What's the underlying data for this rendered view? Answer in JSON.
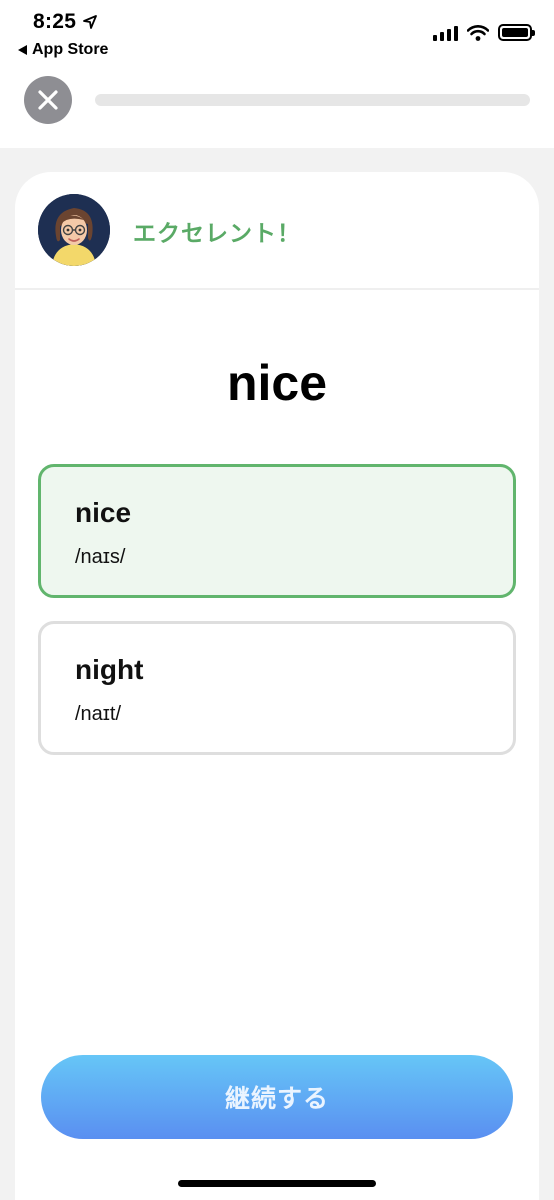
{
  "status_bar": {
    "time": "8:25",
    "back_label": "App Store"
  },
  "header": {
    "progress": 0.0
  },
  "feedback": {
    "message": "エクセレント！",
    "color": "#5aaa66"
  },
  "question": {
    "word": "nice"
  },
  "options": [
    {
      "word": "nice",
      "ipa": "/naɪs/",
      "state": "correct"
    },
    {
      "word": "night",
      "ipa": "/naɪt/",
      "state": "default"
    }
  ],
  "footer": {
    "continue_label": "継続する"
  },
  "colors": {
    "accent_green": "#61b56d",
    "button_gradient_top": "#66c6f7",
    "button_gradient_bottom": "#5a8ff1"
  }
}
